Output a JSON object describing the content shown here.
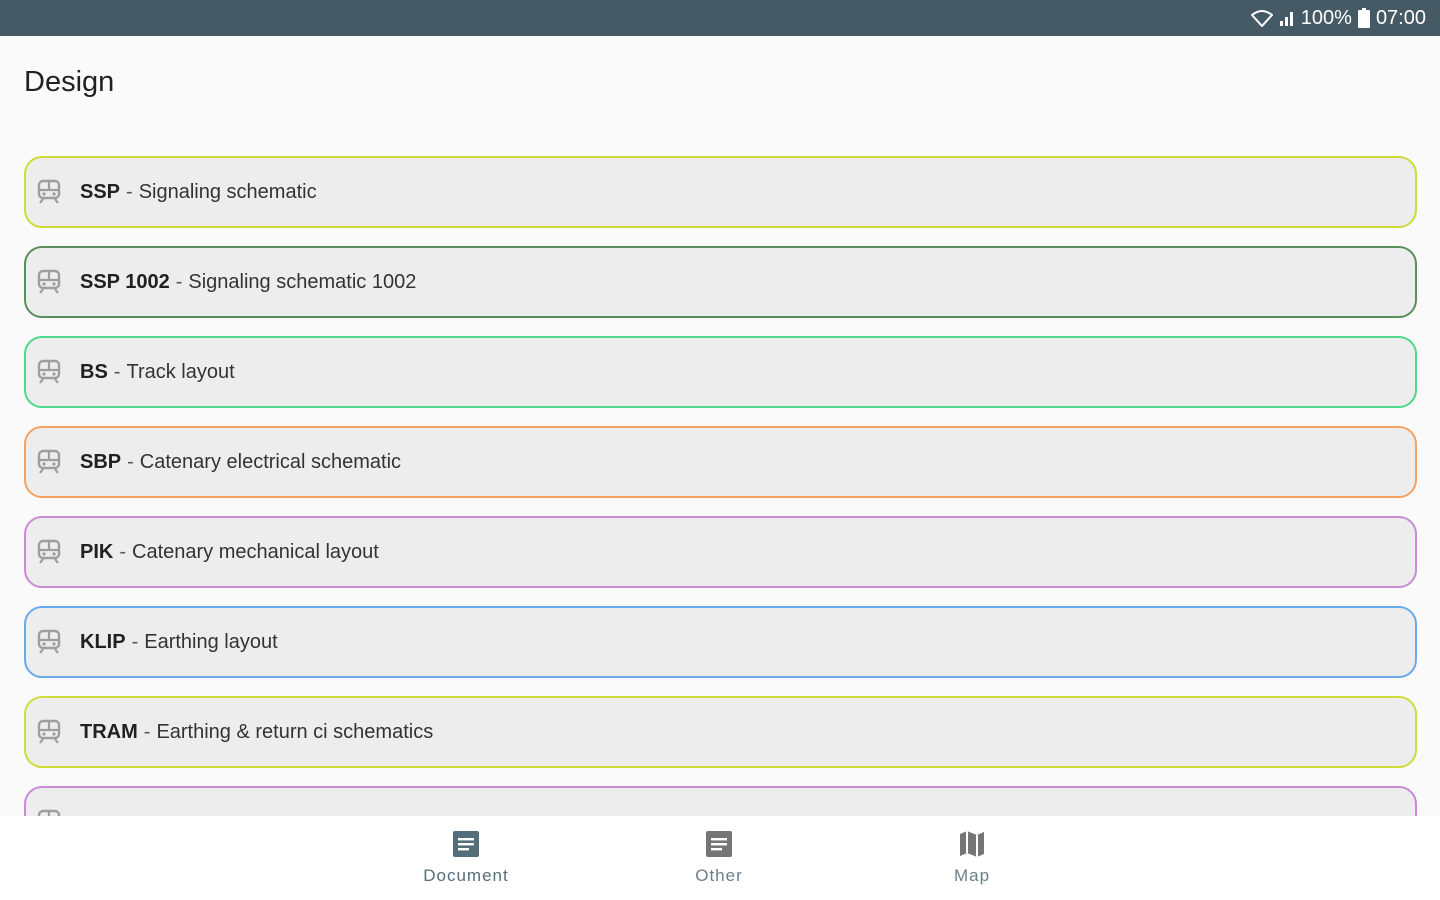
{
  "status_bar": {
    "battery": "100%",
    "time": "07:00"
  },
  "page": {
    "title": "Design"
  },
  "items": [
    {
      "code": "SSP",
      "description": "Signaling schematic",
      "color": "#cddc39"
    },
    {
      "code": "SSP 1002",
      "description": "Signaling schematic 1002",
      "color": "#5a8f5c"
    },
    {
      "code": "BS",
      "description": "Track layout",
      "color": "#4cd98a"
    },
    {
      "code": "SBP",
      "description": "Catenary electrical schematic",
      "color": "#f4a261"
    },
    {
      "code": "PIK",
      "description": "Catenary mechanical layout",
      "color": "#c98bd6"
    },
    {
      "code": "KLIP",
      "description": "Earthing layout",
      "color": "#6aa9e9"
    },
    {
      "code": "TRAM",
      "description": "Earthing & return ci schematics",
      "color": "#cddc39"
    },
    {
      "code": "",
      "description": "",
      "color": "#c98bd6"
    }
  ],
  "bottom_nav": {
    "accent": "#546e7a",
    "items": [
      {
        "label": "Document",
        "icon": "document-icon"
      },
      {
        "label": "Other",
        "icon": "document-icon"
      },
      {
        "label": "Map",
        "icon": "map-icon"
      }
    ]
  }
}
